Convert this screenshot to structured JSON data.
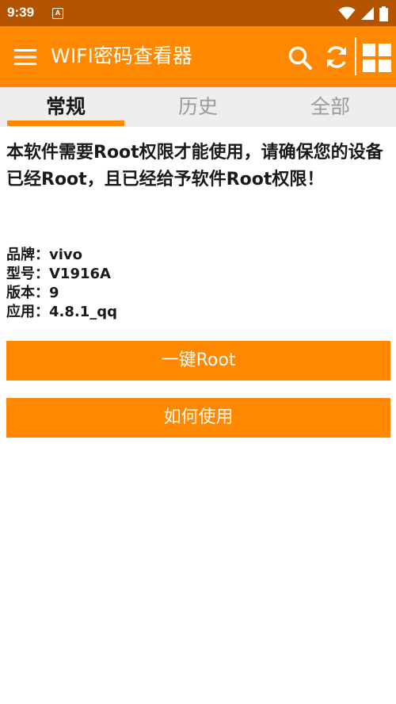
{
  "status_bar": {
    "time": "9:39",
    "notification_glyph": "A",
    "icons": [
      "wifi-icon",
      "signal-icon",
      "battery-icon"
    ]
  },
  "app_bar": {
    "title": "WIFI密码查看器",
    "color": "#ff8800",
    "icons": [
      "menu-icon",
      "search-icon",
      "refresh-icon",
      "grid-icon"
    ]
  },
  "tabs": [
    {
      "label": "常规",
      "active": true
    },
    {
      "label": "历史",
      "active": false
    },
    {
      "label": "全部",
      "active": false
    }
  ],
  "main": {
    "notice": "本软件需要Root权限才能使用，请确保您的设备已经Root，且已经给予软件Root权限！",
    "info": [
      {
        "label": "品牌：",
        "value": "vivo"
      },
      {
        "label": "型号：",
        "value": "V1916A"
      },
      {
        "label": "版本：",
        "value": "9"
      },
      {
        "label": "应用：",
        "value": "4.8.1_qq"
      }
    ],
    "root_button_label": "一键Root",
    "howto_button_label": "如何使用"
  }
}
